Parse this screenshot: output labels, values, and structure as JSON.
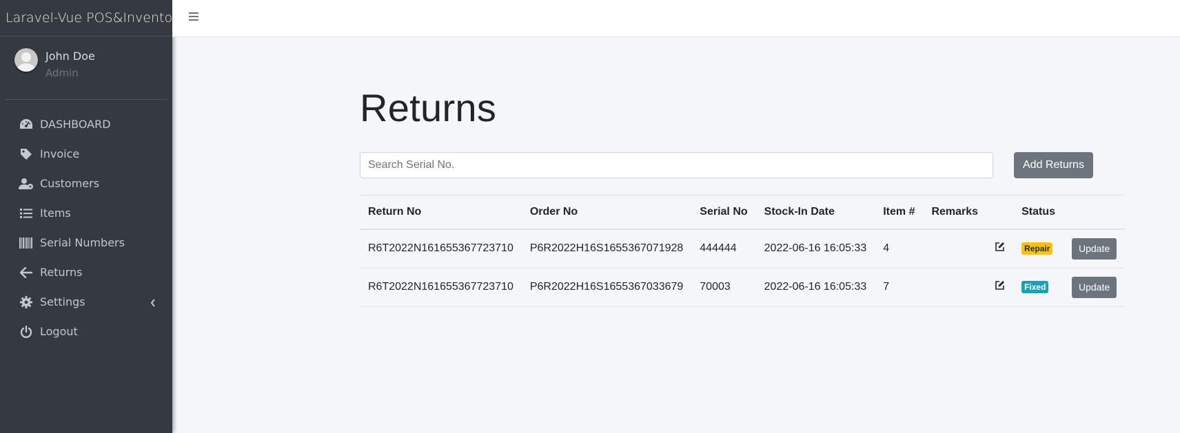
{
  "app": {
    "brand": "Laravel-Vue POS&Inventory"
  },
  "user": {
    "name": "John Doe",
    "role": "Admin"
  },
  "sidebar": {
    "items": [
      {
        "label": "DASHBOARD",
        "icon": "dashboard-gauge-icon"
      },
      {
        "label": "Invoice",
        "icon": "tag-icon"
      },
      {
        "label": "Customers",
        "icon": "users-cog-icon"
      },
      {
        "label": "Items",
        "icon": "list-icon"
      },
      {
        "label": "Serial Numbers",
        "icon": "barcode-icon"
      },
      {
        "label": "Returns",
        "icon": "arrow-left-icon"
      },
      {
        "label": "Settings",
        "icon": "gear-icon",
        "caret": "chevron-left-icon"
      },
      {
        "label": "Logout",
        "icon": "power-icon"
      }
    ]
  },
  "main": {
    "title": "Returns",
    "search": {
      "placeholder": "Search Serial No.",
      "value": ""
    },
    "add_button": "Add Returns",
    "table": {
      "columns": [
        "Return No",
        "Order No",
        "Serial No",
        "Stock-In Date",
        "Item #",
        "Remarks",
        "",
        "Status",
        ""
      ],
      "rows": [
        {
          "return_no": "R6T2022N161655367723710",
          "order_no": "P6R2022H16S1655367071928",
          "serial_no": "444444",
          "stock_in_date": "2022-06-16 16:05:33",
          "item_no": "4",
          "remarks": "",
          "status": "Repair",
          "status_color": "#ffc107",
          "action": "Update"
        },
        {
          "return_no": "R6T2022N161655367723710",
          "order_no": "P6R2022H16S1655367033679",
          "serial_no": "70003",
          "stock_in_date": "2022-06-16 16:05:33",
          "item_no": "7",
          "remarks": "",
          "status": "Fixed",
          "status_color": "#17a2b8",
          "action": "Update"
        }
      ]
    }
  },
  "colors": {
    "sidebar_bg": "#343a40",
    "sidebar_text": "#c2c7d0",
    "secondary_button": "#6c757d",
    "page_bg": "#f4f6f9"
  }
}
